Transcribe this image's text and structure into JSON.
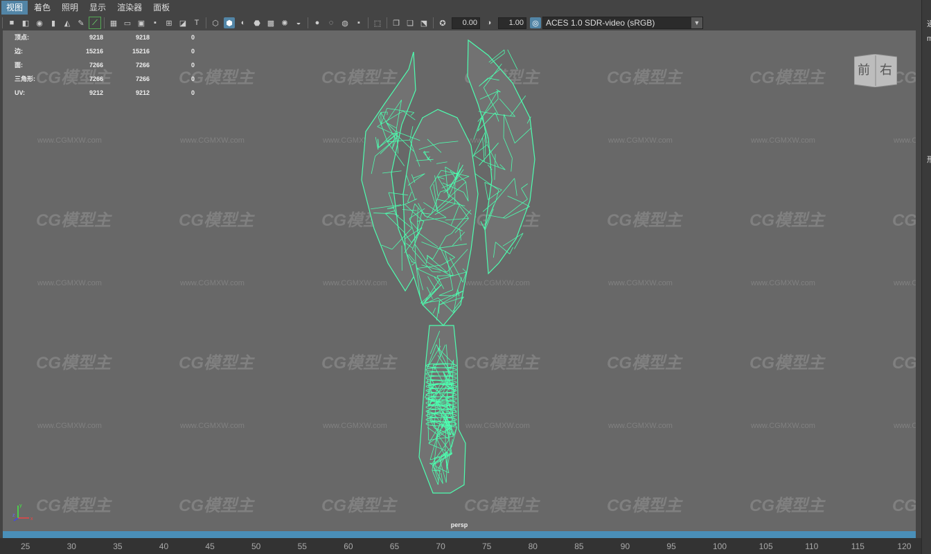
{
  "menubar": {
    "items": [
      "视图",
      "着色",
      "照明",
      "显示",
      "渲染器",
      "面板"
    ]
  },
  "toolbar": {
    "value_field_1": "0.00",
    "value_field_2": "1.00",
    "color_space": "ACES 1.0 SDR-video (sRGB)"
  },
  "hud": {
    "rows": [
      {
        "label": "顶点:",
        "v1": "9218",
        "v2": "9218",
        "v3": "0"
      },
      {
        "label": "边:",
        "v1": "15216",
        "v2": "15216",
        "v3": "0"
      },
      {
        "label": "面:",
        "v1": "7266",
        "v2": "7266",
        "v3": "0"
      },
      {
        "label": "三角形:",
        "v1": "7266",
        "v2": "7266",
        "v3": "0"
      },
      {
        "label": "UV:",
        "v1": "9212",
        "v2": "9212",
        "v3": "0"
      }
    ]
  },
  "viewcube": {
    "front": "前",
    "right": "右"
  },
  "axis": {
    "x": "x",
    "y": "y",
    "z": "z"
  },
  "camera_label": "persp",
  "watermark": {
    "logo": "CG模型主",
    "url": "www.CGMXW.com"
  },
  "timeline": {
    "ticks": [
      "25",
      "30",
      "35",
      "40",
      "45",
      "50",
      "55",
      "60",
      "65",
      "70",
      "75",
      "80",
      "85",
      "90",
      "95",
      "100",
      "105",
      "110",
      "115",
      "120"
    ]
  },
  "right_panel": {
    "chars": [
      "通",
      "m",
      "形"
    ]
  },
  "colors": {
    "wireframe": "#4dffb0",
    "viewport_bg": "#686868",
    "accent": "#5285a6",
    "timeline_bar": "#4a8fb8"
  }
}
